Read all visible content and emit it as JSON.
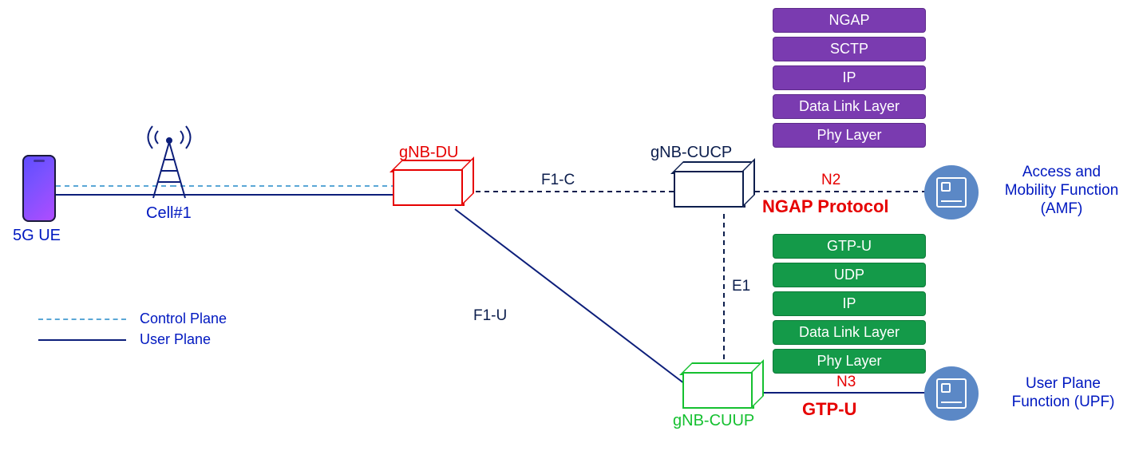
{
  "nodes": {
    "ue": "5G UE",
    "cell": "Cell#1",
    "du": "gNB-DU",
    "cucp": "gNB-CUCP",
    "cuup": "gNB-CUUP",
    "amf_line1": "Access and",
    "amf_line2": "Mobility Function",
    "amf_line3": "(AMF)",
    "upf_line1": "User Plane",
    "upf_line2": "Function (UPF)"
  },
  "links": {
    "f1c": "F1-C",
    "f1u": "F1-U",
    "e1": "E1",
    "n2": "N2",
    "n3": "N3",
    "ngap": "NGAP Protocol",
    "gtpu": "GTP-U"
  },
  "stack_cp": [
    "NGAP",
    "SCTP",
    "IP",
    "Data Link  Layer",
    "Phy Layer"
  ],
  "stack_up": [
    "GTP-U",
    "UDP",
    "IP",
    "Data Link  Layer",
    "Phy Layer"
  ],
  "legend": {
    "cp": "Control Plane",
    "up": "User Plane"
  }
}
